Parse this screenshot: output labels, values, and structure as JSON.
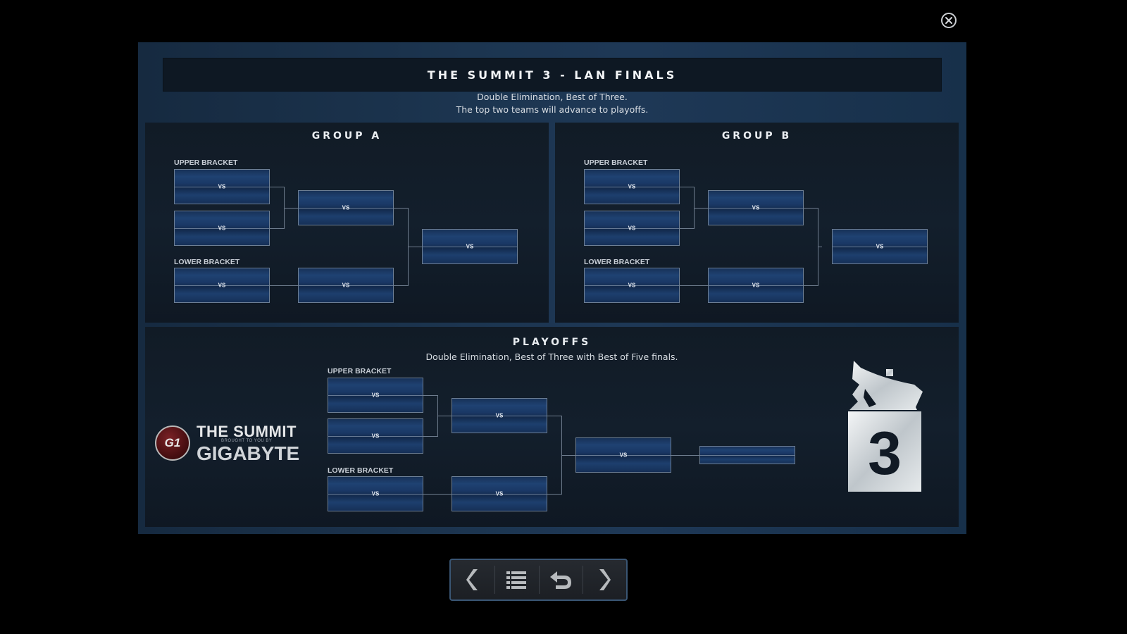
{
  "header": {
    "title": "THE SUMMIT 3 - LAN FINALS",
    "subtitle_line1": "Double Elimination, Best of Three.",
    "subtitle_line2": "The top two teams will advance to playoffs."
  },
  "groups": [
    {
      "title": "GROUP A",
      "upper_label": "UPPER BRACKET",
      "lower_label": "LOWER BRACKET",
      "matches": {
        "ub_round1_a": "VS",
        "ub_round1_b": "VS",
        "ub_final": "VS",
        "lb_round1": "VS",
        "lb_round2": "VS",
        "group_final": "VS"
      }
    },
    {
      "title": "GROUP B",
      "upper_label": "UPPER BRACKET",
      "lower_label": "LOWER BRACKET",
      "matches": {
        "ub_round1_a": "VS",
        "ub_round1_b": "VS",
        "ub_final": "VS",
        "lb_round1": "VS",
        "lb_round2": "VS",
        "group_final": "VS"
      }
    }
  ],
  "playoffs": {
    "title": "PLAYOFFS",
    "subtitle": "Double Elimination, Best of Three with Best of Five finals.",
    "upper_label": "UPPER BRACKET",
    "lower_label": "LOWER BRACKET",
    "matches": {
      "ub_round1_a": "VS",
      "ub_round1_b": "VS",
      "ub_final": "VS",
      "lb_round1": "VS",
      "lb_round2": "VS",
      "grand_final": "VS",
      "champion": ""
    }
  },
  "sponsor": {
    "badge": "G1",
    "line1": "THE SUMMIT",
    "line2": "BROUGHT TO YOU BY",
    "line3": "GIGABYTE"
  },
  "event_logo": {
    "number": "3"
  },
  "nav": {
    "icons": [
      "chevron-left-icon",
      "list-icon",
      "undo-icon",
      "chevron-right-icon"
    ]
  },
  "close": {
    "icon": "close-icon"
  }
}
